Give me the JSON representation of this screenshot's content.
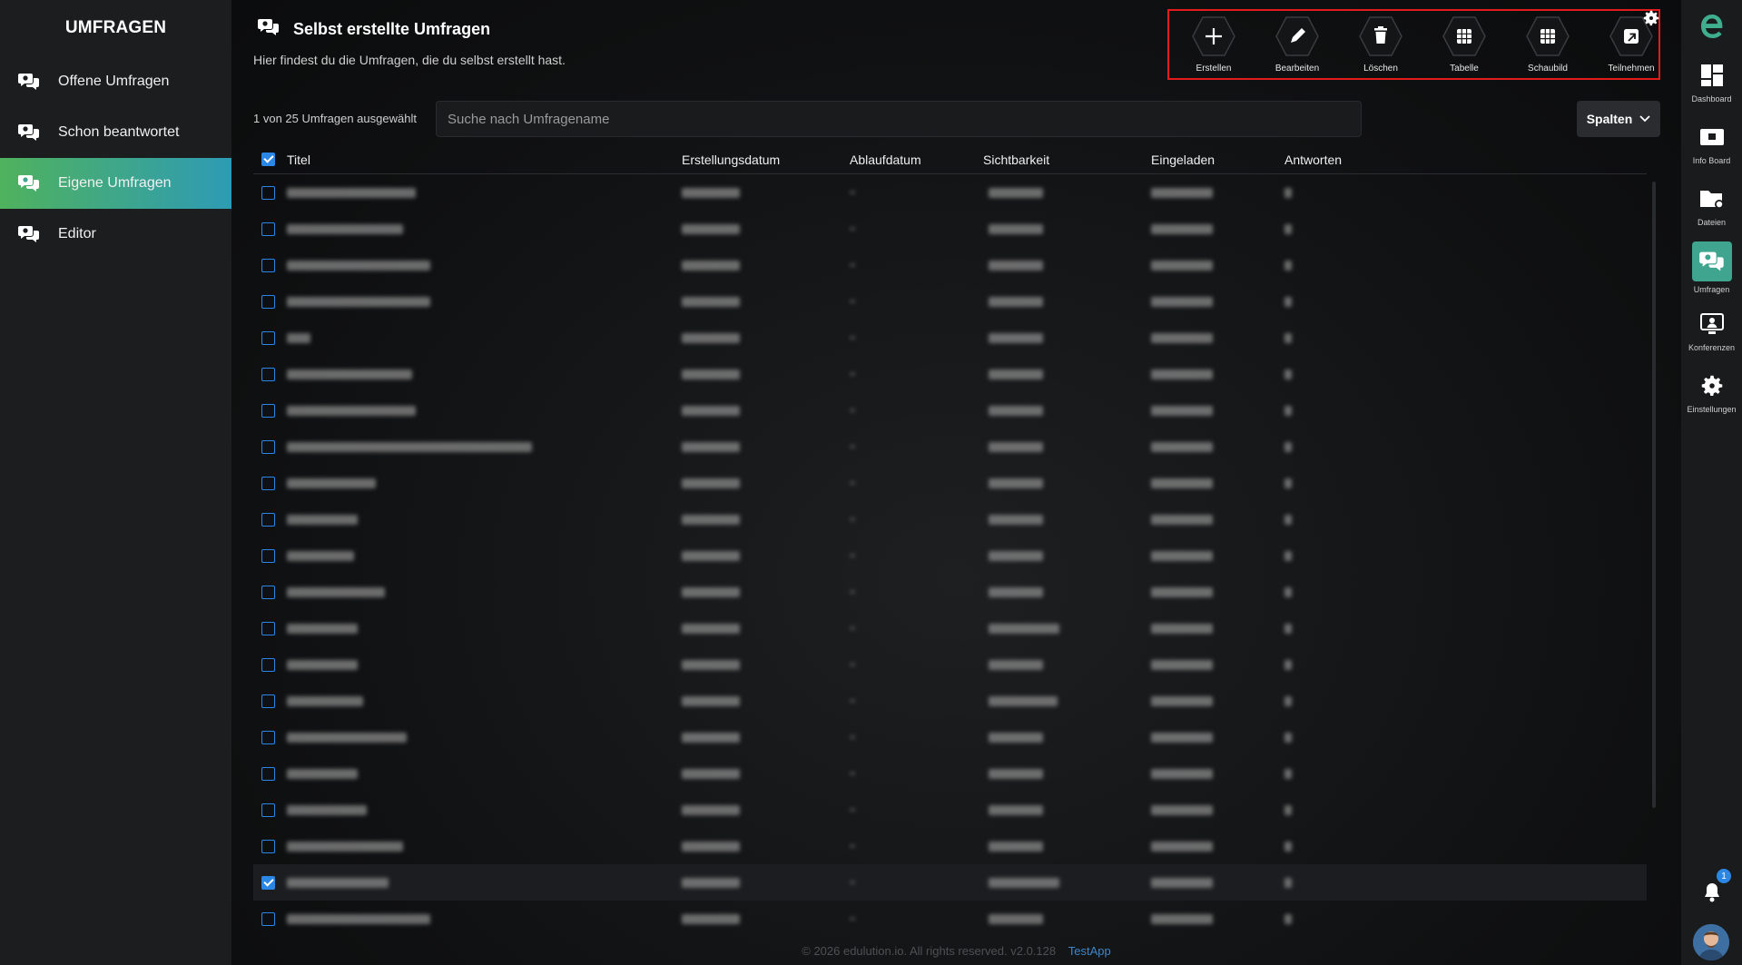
{
  "left_sidebar": {
    "title": "UMFRAGEN",
    "items": [
      {
        "label": "Offene Umfragen",
        "icon": "chat-bubbles-icon",
        "active": false
      },
      {
        "label": "Schon beantwortet",
        "icon": "chat-bubbles-icon",
        "active": false
      },
      {
        "label": "Eigene Umfragen",
        "icon": "chat-bubbles-icon",
        "active": true
      },
      {
        "label": "Editor",
        "icon": "chat-bubbles-icon",
        "active": false
      }
    ]
  },
  "header": {
    "title": "Selbst erstellte Umfragen",
    "description": "Hier findest du die Umfragen, die du selbst erstellt hast."
  },
  "toolbar": {
    "buttons": [
      {
        "label": "Erstellen",
        "icon": "plus-icon"
      },
      {
        "label": "Bearbeiten",
        "icon": "pencil-icon"
      },
      {
        "label": "Löschen",
        "icon": "trash-icon"
      },
      {
        "label": "Tabelle",
        "icon": "grid-icon"
      },
      {
        "label": "Schaubild",
        "icon": "grid-icon"
      },
      {
        "label": "Teilnehmen",
        "icon": "external-link-icon"
      }
    ]
  },
  "filter": {
    "selection_count": "1 von 25 Umfragen ausgewählt",
    "search_placeholder": "Suche nach Umfragename",
    "columns_button": "Spalten"
  },
  "table": {
    "headers": [
      "Titel",
      "Erstellungsdatum",
      "Ablaufdatum",
      "Sichtbarkeit",
      "Eingeladen",
      "Antworten"
    ],
    "header_checkbox_checked": true,
    "rows_blurred": true,
    "row_count": 21,
    "selected_row_index": 19
  },
  "footer": {
    "text": "© 2026 edulution.io. All rights reserved. v2.0.128",
    "link": "TestApp"
  },
  "right_sidebar": {
    "items": [
      {
        "label": "Dashboard",
        "icon": "dashboard-icon"
      },
      {
        "label": "Info Board",
        "icon": "info-board-icon"
      },
      {
        "label": "Dateien",
        "icon": "folder-icon"
      },
      {
        "label": "Umfragen",
        "icon": "chat-bubbles-icon",
        "active": true
      },
      {
        "label": "Konferenzen",
        "icon": "conference-icon"
      },
      {
        "label": "Einstellungen",
        "icon": "gear-icon"
      }
    ],
    "notification_count": "1"
  },
  "colors": {
    "accent_gradient_start": "#4fb25d",
    "accent_gradient_end": "#2e9bb5",
    "checkbox_blue": "#2b87e6",
    "toolbar_highlight": "#e21b1b"
  }
}
